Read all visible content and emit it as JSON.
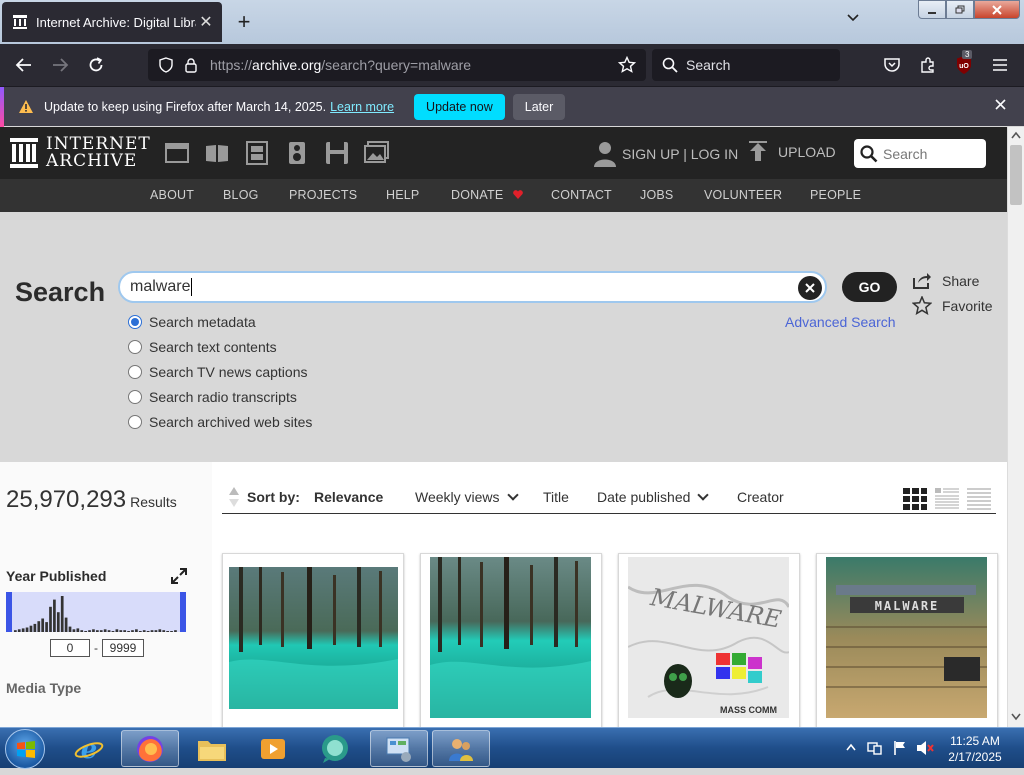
{
  "browser": {
    "tab_title": "Internet Archive: Digital Library",
    "tab_close": "✕",
    "new_tab": "+",
    "url_prefix": "https://",
    "url_host": "archive.org",
    "url_path": "/search?query=malware",
    "search_placeholder": "Search",
    "extension_badge": "3"
  },
  "notification": {
    "message": "Update to keep using Firefox after March 14, 2025.",
    "link": "Learn more",
    "update_button": "Update now",
    "later_button": "Later"
  },
  "ia_header": {
    "logo_line1": "INTERNET",
    "logo_line2": "ARCHIVE",
    "signup": "SIGN UP | LOG IN",
    "upload": "UPLOAD",
    "search_placeholder": "Search"
  },
  "ia_nav": [
    "ABOUT",
    "BLOG",
    "PROJECTS",
    "HELP",
    "DONATE",
    "CONTACT",
    "JOBS",
    "VOLUNTEER",
    "PEOPLE"
  ],
  "search": {
    "title": "Search",
    "query": "malware",
    "go": "GO",
    "share": "Share",
    "favorite": "Favorite",
    "advanced": "Advanced Search",
    "options": [
      {
        "label": "Search metadata",
        "selected": true
      },
      {
        "label": "Search text contents",
        "selected": false
      },
      {
        "label": "Search TV news captions",
        "selected": false
      },
      {
        "label": "Search radio transcripts",
        "selected": false
      },
      {
        "label": "Search archived web sites",
        "selected": false
      }
    ]
  },
  "results": {
    "count": "25,970,293",
    "count_label": "Results",
    "year_title": "Year Published",
    "year_from": "0",
    "year_sep": "-",
    "year_to": "9999",
    "media_type": "Media Type",
    "histogram": [
      2,
      3,
      4,
      5,
      7,
      9,
      12,
      15,
      11,
      28,
      36,
      22,
      40,
      16,
      6,
      3,
      4,
      2,
      1,
      2,
      3,
      2,
      2,
      3,
      2,
      1,
      3,
      2,
      2,
      1,
      2,
      3,
      1,
      2,
      1,
      2,
      2,
      3,
      2,
      1,
      1,
      2
    ],
    "sort_label": "Sort by:",
    "sort_options": [
      {
        "label": "Relevance",
        "active": true,
        "dropdown": false
      },
      {
        "label": "Weekly views",
        "active": false,
        "dropdown": true
      },
      {
        "label": "Title",
        "active": false,
        "dropdown": false
      },
      {
        "label": "Date published",
        "active": false,
        "dropdown": true
      },
      {
        "label": "Creator",
        "active": false,
        "dropdown": false
      }
    ],
    "card_image_text": [
      "MALWARE",
      "MASS COMM",
      "MALWARE"
    ]
  },
  "taskbar": {
    "time": "11:25 AM",
    "date": "2/17/2025"
  },
  "colors": {
    "firefox_dark": "#2b2a33",
    "ia_header": "#232323",
    "update_button": "#00ddff",
    "link_blue": "#4b65d6",
    "radio_blue": "#2b6fd6",
    "donate_heart": "#e0202a"
  }
}
